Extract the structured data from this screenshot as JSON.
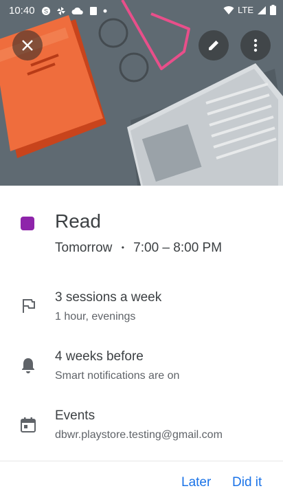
{
  "status_bar": {
    "time": "10:40",
    "network": "LTE"
  },
  "hero": {
    "icons": [
      "close-icon",
      "edit-icon",
      "more-vert-icon"
    ]
  },
  "goal": {
    "title": "Read",
    "when_day": "Tomorrow",
    "when_sep": "•",
    "when_time": "7:00 – 8:00 PM",
    "color": "#8e24aa"
  },
  "details": [
    {
      "icon": "flag-icon",
      "primary": "3 sessions a week",
      "secondary": "1 hour, evenings"
    },
    {
      "icon": "bell-icon",
      "primary": "4 weeks before",
      "secondary": "Smart notifications are on"
    },
    {
      "icon": "calendar-icon",
      "primary": "Events",
      "secondary": "dbwr.playstore.testing@gmail.com"
    }
  ],
  "footer": {
    "later_label": "Later",
    "did_it_label": "Did it"
  }
}
